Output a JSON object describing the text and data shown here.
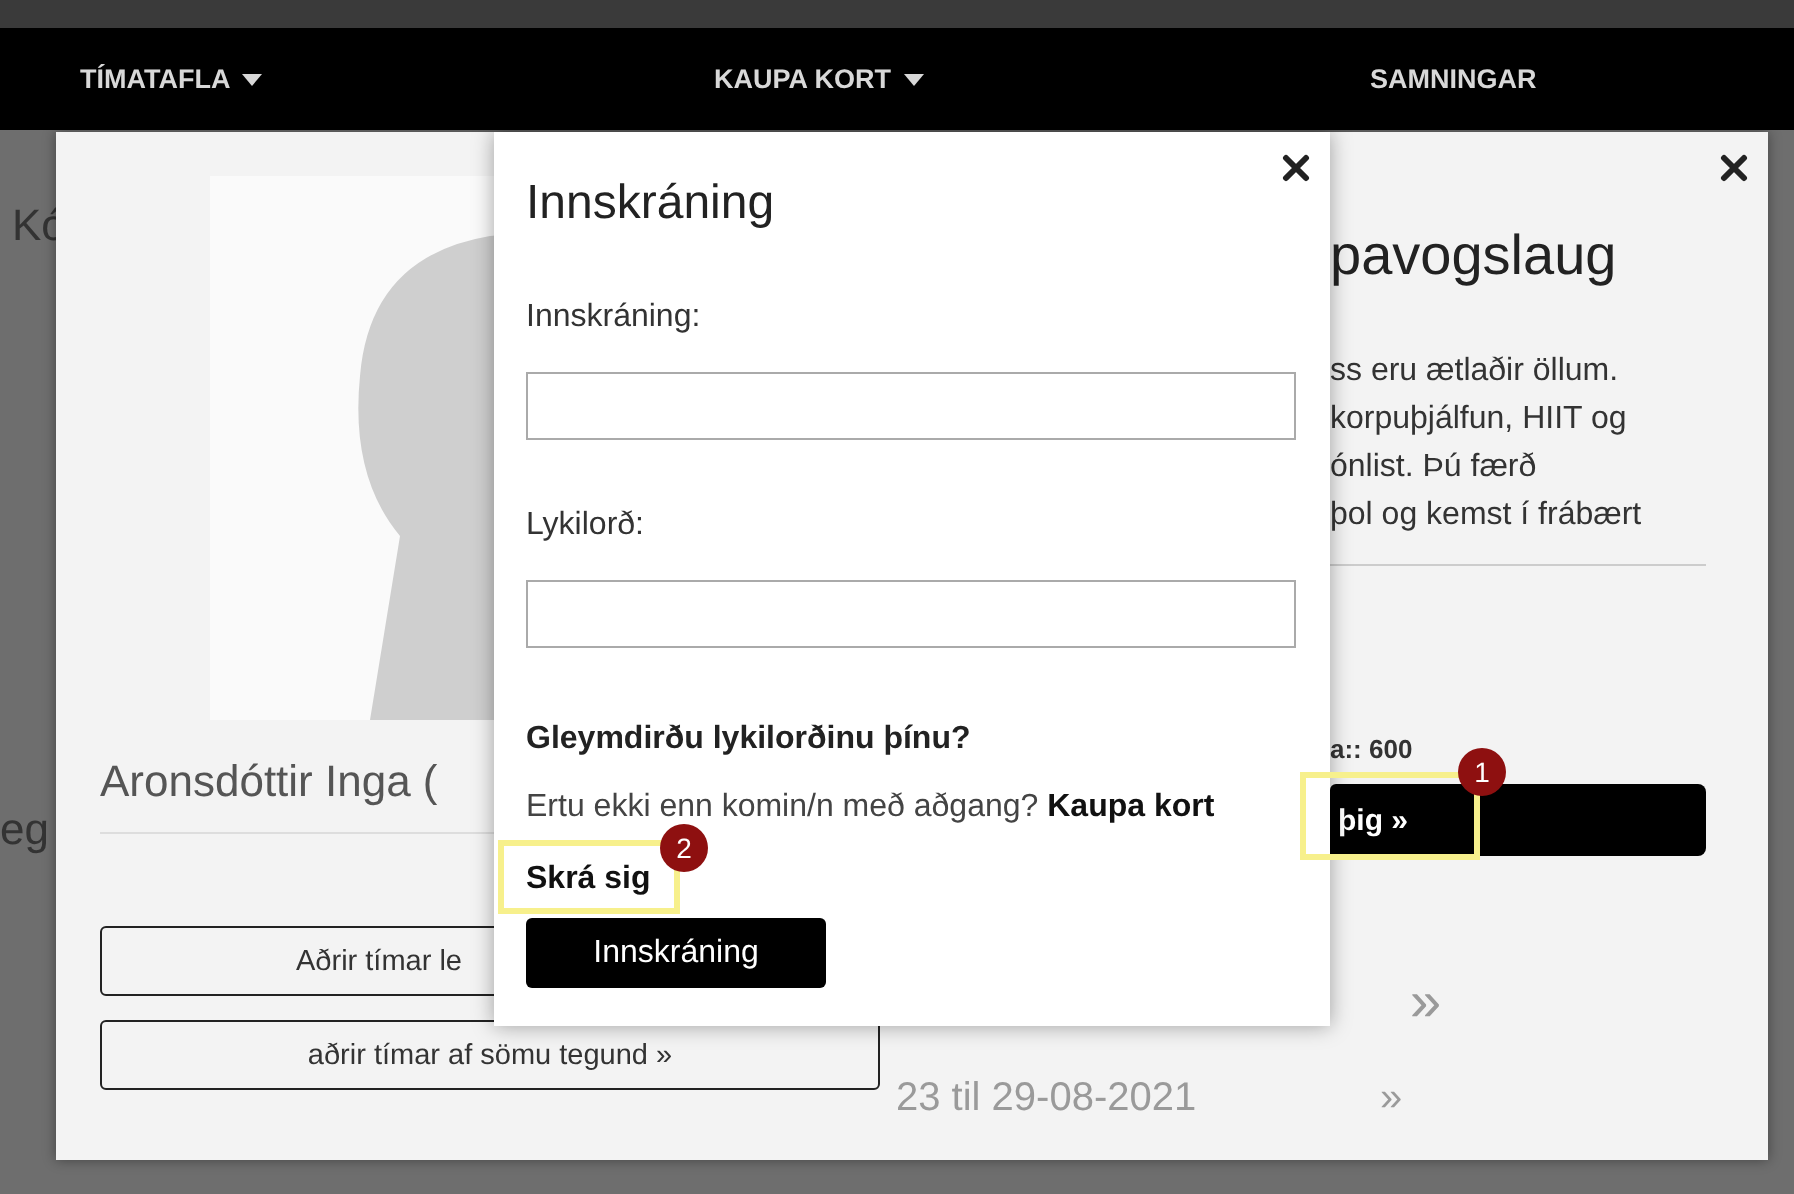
{
  "nav": [
    {
      "label": "TÍMATAFLA",
      "dropdown": true
    },
    {
      "label": "KAUPA KORT",
      "dropdown": true
    },
    {
      "label": "SAMNINGAR",
      "dropdown": false
    }
  ],
  "background_page": {
    "fragments": [
      "Kó",
      "eg"
    ]
  },
  "class_dialog": {
    "name": "Aronsdóttir Inga (",
    "buttons": [
      "Aðrir tímar le",
      "aðrir tímar af sömu tegund »"
    ],
    "title": "pavogslaug",
    "description": [
      "ss eru ætlaðir öllum.",
      "korpuþjálfun, HIIT og",
      "ónlist. Þú færð",
      "þol og kemst í frábært"
    ],
    "info": "a:: 600",
    "signup_button": "þig »",
    "carousel": {
      "next": "»",
      "week": "23 til 29-08-2021",
      "week_next": "»"
    }
  },
  "login_dialog": {
    "title": "Innskráning",
    "username_label": "Innskráning:",
    "password_label": "Lykilorð:",
    "forgot": "Gleymdirðu lykilorðinu þínu?",
    "no_account": "Ertu ekki enn komin/n með aðgang?",
    "buy_link": "Kaupa kort",
    "register_link": "Skrá sig",
    "submit": "Innskráning"
  },
  "annotations": [
    {
      "number": "1"
    },
    {
      "number": "2"
    }
  ]
}
